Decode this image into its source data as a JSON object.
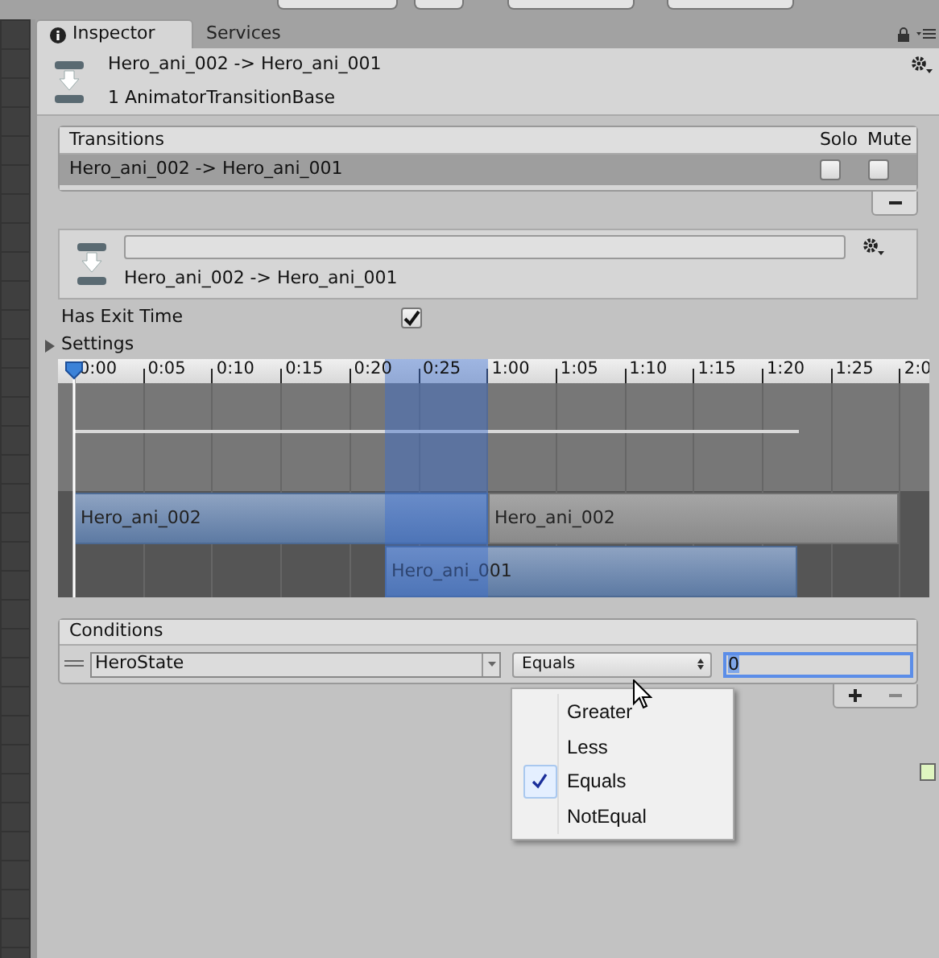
{
  "tabs": [
    {
      "label": "Inspector",
      "selected": true
    },
    {
      "label": "Services",
      "selected": false
    }
  ],
  "header": {
    "title": "Hero_ani_002 -> Hero_ani_001",
    "subtitle": "1 AnimatorTransitionBase"
  },
  "transitions": {
    "title": "Transitions",
    "columns": [
      "Solo",
      "Mute"
    ],
    "rows": [
      {
        "name": "Hero_ani_002 -> Hero_ani_001",
        "selected": true,
        "solo": false,
        "mute": false
      }
    ]
  },
  "transition": {
    "label": "Hero_ani_002 -> Hero_ani_001"
  },
  "has_exit_time": {
    "label": "Has Exit Time",
    "checked": true
  },
  "settings": {
    "label": "Settings",
    "expanded": false
  },
  "timeline": {
    "ticks": [
      "0:00",
      "0:05",
      "0:10",
      "0:15",
      "0:20",
      "0:25",
      "1:00",
      "1:05",
      "1:10",
      "1:15",
      "1:20",
      "1:25",
      "2:0"
    ],
    "clips": [
      {
        "name": "Hero_ani_002",
        "kind": "source"
      },
      {
        "name": "Hero_ani_002",
        "kind": "after"
      },
      {
        "name": "Hero_ani_001",
        "kind": "destination"
      }
    ]
  },
  "conditions": {
    "title": "Conditions",
    "rows": [
      {
        "parameter": "HeroState",
        "mode": "Equals",
        "value": "0"
      }
    ]
  },
  "mode_menu": {
    "options": [
      {
        "label": "Greater",
        "selected": false
      },
      {
        "label": "Less",
        "selected": false
      },
      {
        "label": "Equals",
        "selected": true
      },
      {
        "label": "NotEqual",
        "selected": false
      }
    ]
  }
}
